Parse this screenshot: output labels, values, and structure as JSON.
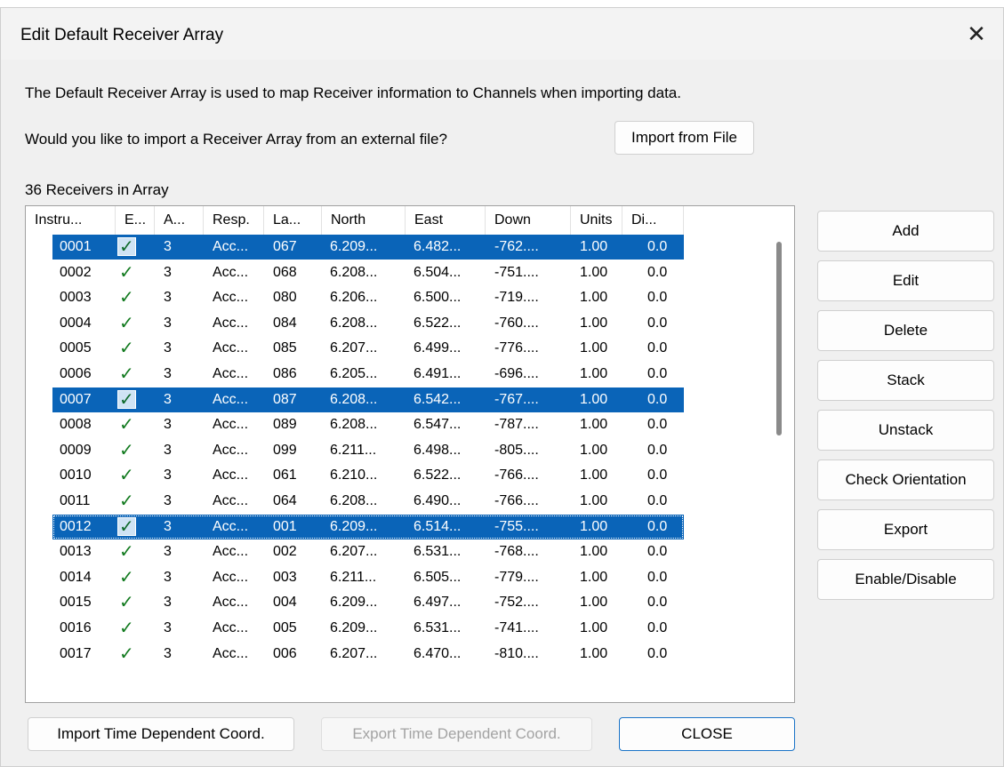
{
  "window": {
    "title": "Edit Default Receiver Array",
    "close_glyph": "✕"
  },
  "intro_text": "The Default Receiver Array is used to map Receiver information to Channels when importing data.",
  "import_prompt": "Would you like to import a Receiver Array from an external file?",
  "import_from_file_label": "Import from File",
  "receiver_count_label": "36 Receivers in Array",
  "table": {
    "columns": [
      "Instru...",
      "E...",
      "A...",
      "Resp.",
      "La...",
      "North",
      "East",
      "Down",
      "Units",
      "Di..."
    ],
    "rows": [
      {
        "instr": "0001",
        "enabled": "✓",
        "a": "3",
        "resp": "Acc...",
        "la": "067",
        "north": "6.209...",
        "east": "6.482...",
        "down": "-762....",
        "units": "1.00",
        "di": "0.0",
        "selected": true
      },
      {
        "instr": "0002",
        "enabled": "✓",
        "a": "3",
        "resp": "Acc...",
        "la": "068",
        "north": "6.208...",
        "east": "6.504...",
        "down": "-751....",
        "units": "1.00",
        "di": "0.0",
        "selected": false
      },
      {
        "instr": "0003",
        "enabled": "✓",
        "a": "3",
        "resp": "Acc...",
        "la": "080",
        "north": "6.206...",
        "east": "6.500...",
        "down": "-719....",
        "units": "1.00",
        "di": "0.0",
        "selected": false
      },
      {
        "instr": "0004",
        "enabled": "✓",
        "a": "3",
        "resp": "Acc...",
        "la": "084",
        "north": "6.208...",
        "east": "6.522...",
        "down": "-760....",
        "units": "1.00",
        "di": "0.0",
        "selected": false
      },
      {
        "instr": "0005",
        "enabled": "✓",
        "a": "3",
        "resp": "Acc...",
        "la": "085",
        "north": "6.207...",
        "east": "6.499...",
        "down": "-776....",
        "units": "1.00",
        "di": "0.0",
        "selected": false
      },
      {
        "instr": "0006",
        "enabled": "✓",
        "a": "3",
        "resp": "Acc...",
        "la": "086",
        "north": "6.205...",
        "east": "6.491...",
        "down": "-696....",
        "units": "1.00",
        "di": "0.0",
        "selected": false
      },
      {
        "instr": "0007",
        "enabled": "✓",
        "a": "3",
        "resp": "Acc...",
        "la": "087",
        "north": "6.208...",
        "east": "6.542...",
        "down": "-767....",
        "units": "1.00",
        "di": "0.0",
        "selected": true
      },
      {
        "instr": "0008",
        "enabled": "✓",
        "a": "3",
        "resp": "Acc...",
        "la": "089",
        "north": "6.208...",
        "east": "6.547...",
        "down": "-787....",
        "units": "1.00",
        "di": "0.0",
        "selected": false
      },
      {
        "instr": "0009",
        "enabled": "✓",
        "a": "3",
        "resp": "Acc...",
        "la": "099",
        "north": "6.211...",
        "east": "6.498...",
        "down": "-805....",
        "units": "1.00",
        "di": "0.0",
        "selected": false
      },
      {
        "instr": "0010",
        "enabled": "✓",
        "a": "3",
        "resp": "Acc...",
        "la": "061",
        "north": "6.210...",
        "east": "6.522...",
        "down": "-766....",
        "units": "1.00",
        "di": "0.0",
        "selected": false
      },
      {
        "instr": "0011",
        "enabled": "✓",
        "a": "3",
        "resp": "Acc...",
        "la": "064",
        "north": "6.208...",
        "east": "6.490...",
        "down": "-766....",
        "units": "1.00",
        "di": "0.0",
        "selected": false
      },
      {
        "instr": "0012",
        "enabled": "✓",
        "a": "3",
        "resp": "Acc...",
        "la": "001",
        "north": "6.209...",
        "east": "6.514...",
        "down": "-755....",
        "units": "1.00",
        "di": "0.0",
        "selected": true,
        "focused": true
      },
      {
        "instr": "0013",
        "enabled": "✓",
        "a": "3",
        "resp": "Acc...",
        "la": "002",
        "north": "6.207...",
        "east": "6.531...",
        "down": "-768....",
        "units": "1.00",
        "di": "0.0",
        "selected": false
      },
      {
        "instr": "0014",
        "enabled": "✓",
        "a": "3",
        "resp": "Acc...",
        "la": "003",
        "north": "6.211...",
        "east": "6.505...",
        "down": "-779....",
        "units": "1.00",
        "di": "0.0",
        "selected": false
      },
      {
        "instr": "0015",
        "enabled": "✓",
        "a": "3",
        "resp": "Acc...",
        "la": "004",
        "north": "6.209...",
        "east": "6.497...",
        "down": "-752....",
        "units": "1.00",
        "di": "0.0",
        "selected": false
      },
      {
        "instr": "0016",
        "enabled": "✓",
        "a": "3",
        "resp": "Acc...",
        "la": "005",
        "north": "6.209...",
        "east": "6.531...",
        "down": "-741....",
        "units": "1.00",
        "di": "0.0",
        "selected": false
      },
      {
        "instr": "0017",
        "enabled": "✓",
        "a": "3",
        "resp": "Acc...",
        "la": "006",
        "north": "6.207...",
        "east": "6.470...",
        "down": "-810....",
        "units": "1.00",
        "di": "0.0",
        "selected": false
      }
    ]
  },
  "side_buttons": [
    "Add",
    "Edit",
    "Delete",
    "Stack",
    "Unstack",
    "Check Orientation",
    "Export",
    "Enable/Disable"
  ],
  "bottom": {
    "import_time_label": "Import Time Dependent Coord.",
    "export_time_label": "Export Time Dependent Coord.",
    "close_label": "CLOSE"
  },
  "colors": {
    "selection": "#0a64b8",
    "check": "#127a1f",
    "dialog_bg": "#f0f0f0"
  }
}
